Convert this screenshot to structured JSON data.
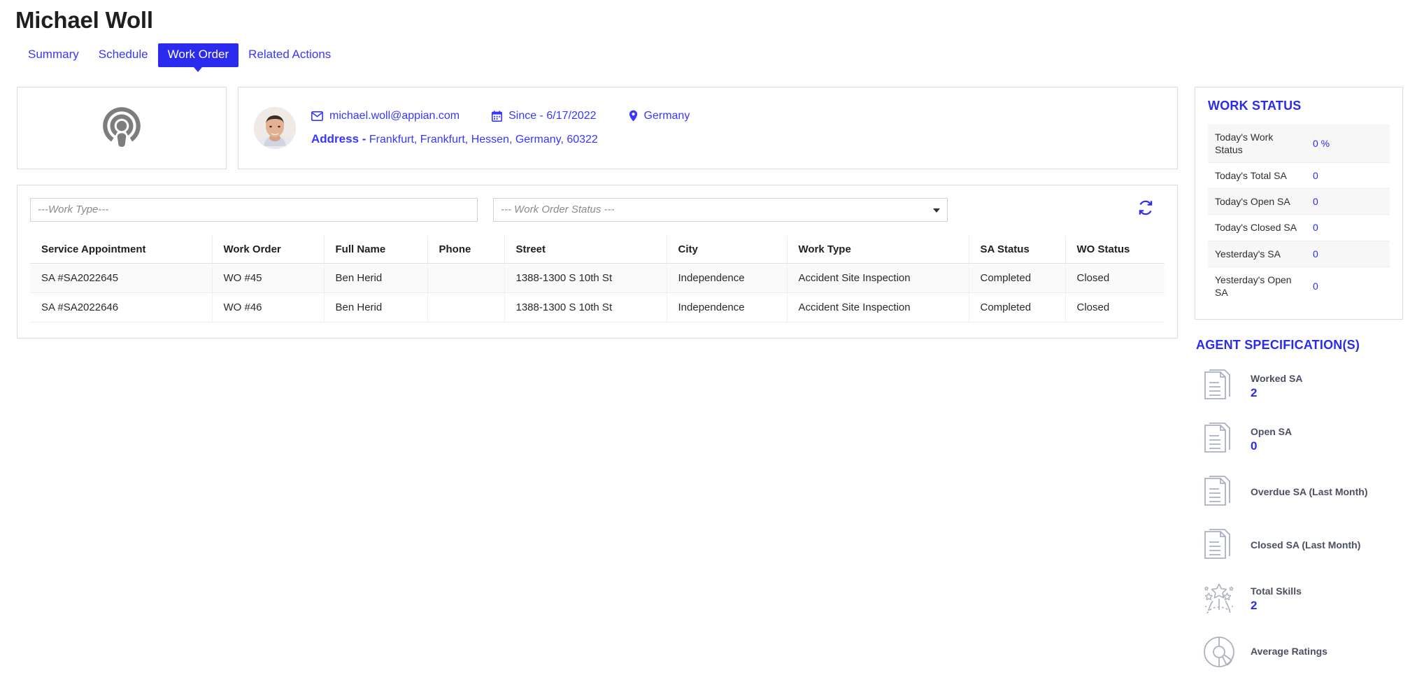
{
  "header": {
    "title": "Michael Woll",
    "tabs": [
      {
        "label": "Summary",
        "active": false
      },
      {
        "label": "Schedule",
        "active": false
      },
      {
        "label": "Work Order",
        "active": true
      },
      {
        "label": "Related Actions",
        "active": false
      }
    ]
  },
  "profile": {
    "logo_icon": "podcast-icon",
    "avatar_alt": "user-avatar",
    "email": "michael.woll@appian.com",
    "email_icon": "envelope-icon",
    "since": "Since - 6/17/2022",
    "since_icon": "calendar-icon",
    "country": "Germany",
    "country_icon": "location-pin-icon",
    "address_label": "Address -",
    "address_value": "Frankfurt, Frankfurt, Hessen, Germany, 60322"
  },
  "filters": {
    "work_type_placeholder": "---Work Type---",
    "work_type_value": "",
    "work_order_status_placeholder": "--- Work Order Status ---",
    "work_order_status_value": "",
    "refresh_icon": "refresh-icon"
  },
  "table": {
    "columns": [
      "Service Appointment",
      "Work Order",
      "Full Name",
      "Phone",
      "Street",
      "City",
      "Work Type",
      "SA Status",
      "WO Status"
    ],
    "rows": [
      {
        "service_appointment": "SA #SA2022645",
        "work_order": "WO #45",
        "full_name": "Ben Herid",
        "phone": "",
        "street": "1388-1300 S 10th St",
        "city": "Independence",
        "work_type": "Accident Site Inspection",
        "sa_status": "Completed",
        "wo_status": "Closed"
      },
      {
        "service_appointment": "SA #SA2022646",
        "work_order": "WO #46",
        "full_name": "Ben Herid",
        "phone": "",
        "street": "1388-1300 S 10th St",
        "city": "Independence",
        "work_type": "Accident Site Inspection",
        "sa_status": "Completed",
        "wo_status": "Closed"
      }
    ]
  },
  "work_status": {
    "title": "WORK STATUS",
    "rows": [
      {
        "label": "Today's Work Status",
        "value": "0 %"
      },
      {
        "label": "Today's Total SA",
        "value": "0"
      },
      {
        "label": "Today's Open SA",
        "value": "0"
      },
      {
        "label": "Today's Closed SA",
        "value": "0"
      },
      {
        "label": "Yesterday's SA",
        "value": "0"
      },
      {
        "label": "Yesterday's Open SA",
        "value": "0"
      }
    ]
  },
  "agent_specifications": {
    "title": "AGENT SPECIFICATION(S)",
    "items": [
      {
        "label": "Worked SA",
        "value": "2",
        "icon": "documents-icon"
      },
      {
        "label": "Open SA",
        "value": "0",
        "icon": "documents-icon"
      },
      {
        "label": "Overdue SA (Last Month)",
        "value": "",
        "icon": "documents-icon"
      },
      {
        "label": "Closed SA (Last Month)",
        "value": "",
        "icon": "documents-icon"
      },
      {
        "label": "Total Skills",
        "value": "2",
        "icon": "fireworks-stars-icon"
      },
      {
        "label": "Average Ratings",
        "value": "",
        "icon": "donut-chart-icon"
      }
    ]
  },
  "colors": {
    "accent": "#2b2bf0",
    "link": "#3737ff",
    "icon_gray": "#7d7d7d",
    "panel_icon": "#aab0c0"
  }
}
